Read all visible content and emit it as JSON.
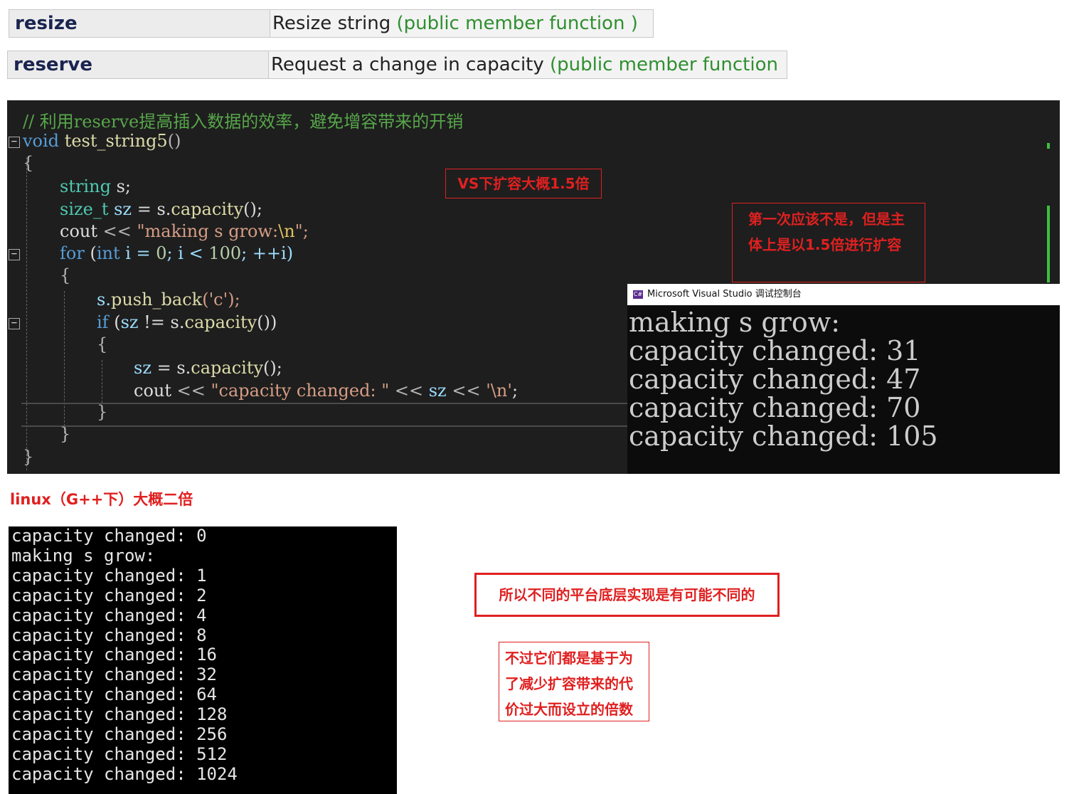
{
  "reference": {
    "rows": [
      {
        "name": "resize",
        "description": "Resize string",
        "kind": "(public member function )"
      },
      {
        "name": "reserve",
        "description": "Request a change in capacity",
        "kind": "(public member function"
      }
    ]
  },
  "code": {
    "comment": "// 利用reserve提高插入数据的效率，避免增容带来的开销",
    "signature_kw": "void",
    "signature_name": "test_string5",
    "signature_parens": "()",
    "lines": {
      "open_brace": "{",
      "decl_string_type": "string",
      "decl_string_rest": " s;",
      "decl_size_type": "size_t",
      "decl_size_var": " sz",
      "decl_size_rest": " = s.",
      "decl_size_call": "capacity",
      "decl_size_end": "();",
      "cout1_kw": "cout",
      "cout1_op": " << ",
      "cout1_str": "\"making s grow:",
      "cout1_esc": "\\n",
      "cout1_end": "\";",
      "for_kw": "for",
      "for_paren": " (",
      "for_int": "int",
      "for_rest": " i = ",
      "for_zero": "0",
      "for_mid": "; i < ",
      "for_hundred": "100",
      "for_end": "; ++i)",
      "inner_open": "{",
      "push_obj": "s.",
      "push_call": "push_back",
      "push_args": "('c');",
      "if_kw": "if",
      "if_paren": " (",
      "if_var": "sz",
      "if_rest": " != s.",
      "if_call": "capacity",
      "if_end": "())",
      "if_open": "{",
      "assign_var": "sz",
      "assign_rest": " = s.",
      "assign_call": "capacity",
      "assign_end": "();",
      "cout2_kw": "cout",
      "cout2_op": " << ",
      "cout2_str": "\"capacity changed: \"",
      "cout2_op2": " << ",
      "cout2_var": "sz",
      "cout2_op3": " << ",
      "cout2_char": "'\\n'",
      "cout2_end": ";",
      "if_close": "}",
      "inner_close": "}",
      "close_brace": "}"
    }
  },
  "annotations": {
    "vs_note": "VS下扩容大概1.5倍",
    "first_note": "第一次应该不是，但是主体上是以1.5倍进行扩容",
    "platform_note": "所以不同的平台底层实现是有可能不同的",
    "reason_note": "不过它们都是基于为了减少扩容带来的代价过大而设立的倍数",
    "linux_label": "linux（G++下）大概二倍"
  },
  "vs_console": {
    "title": "Microsoft Visual Studio 调试控制台",
    "logo": "C#",
    "lines": [
      "making s grow:",
      "capacity changed: 31",
      "capacity changed: 47",
      "capacity changed: 70",
      "capacity changed: 105"
    ]
  },
  "linux_console": {
    "lines": [
      "capacity changed: 0",
      "making s grow:",
      "capacity changed: 1",
      "capacity changed: 2",
      "capacity changed: 4",
      "capacity changed: 8",
      "capacity changed: 16",
      "capacity changed: 32",
      "capacity changed: 64",
      "capacity changed: 128",
      "capacity changed: 256",
      "capacity changed: 512",
      "capacity changed: 1024"
    ]
  },
  "colors": {
    "annotation_red": "#e02020",
    "editor_bg": "#1e1e1e",
    "console_bg": "#0c0c0c"
  }
}
